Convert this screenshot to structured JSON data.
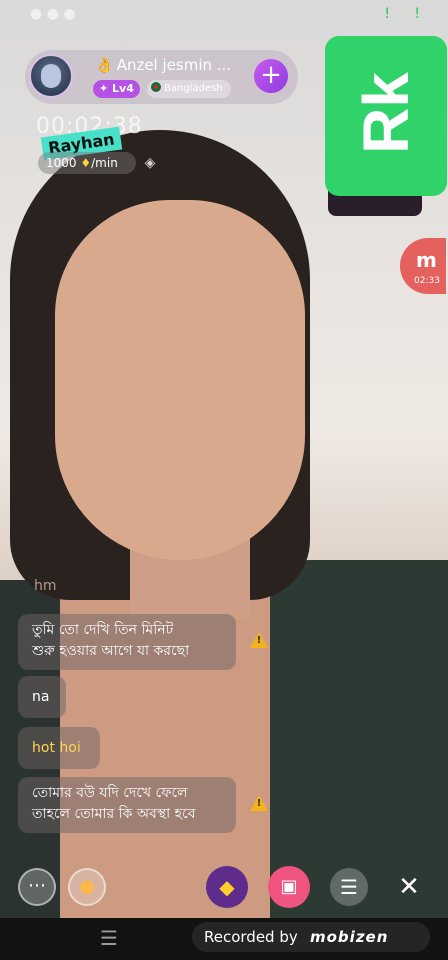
{
  "host": {
    "name": "Anzel jesmin ...",
    "level": "Lv4",
    "country": "Bangladesh",
    "follow_label": "+"
  },
  "stream": {
    "timer": "00:02:38",
    "watermark_name": "Rayhan",
    "rate": "1000",
    "rate_unit": "/min"
  },
  "overlay": {
    "rk_label": "Rk",
    "mini_badge_letter": "m",
    "mini_badge_time": "02:33"
  },
  "chat": {
    "hm": "hm",
    "messages": [
      {
        "text": "তুমি তো দেখি তিন মিনিট\nশুরু হওয়ার আগে যা করছো",
        "warning": true
      },
      {
        "text": "na",
        "warning": false
      },
      {
        "text": "hot hoi",
        "warning": false
      },
      {
        "text": "তোমার বউ যদি দেখে ফেলে\nতাহলে তোমার কি অবস্থা হবে",
        "warning": true
      }
    ]
  },
  "toolbar": {
    "chat_icon": "chat-bubble-icon",
    "lightbulb_icon": "lightbulb-icon",
    "gem_icon": "gem-icon",
    "gift_icon": "gift-icon",
    "menu_icon": "menu-icon",
    "close_label": "✕"
  },
  "recorder": {
    "label": "Recorded by",
    "brand": "mobizen"
  },
  "colors": {
    "accent_purple": "#b651e6",
    "rk_green": "#2fd36a",
    "chat_yellow": "#ffd44a"
  }
}
